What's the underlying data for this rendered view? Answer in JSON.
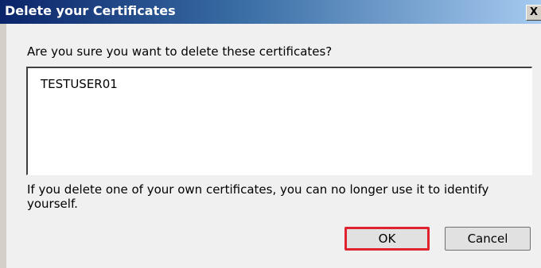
{
  "dialog": {
    "title": "Delete your Certificates",
    "close_label": "X",
    "prompt": "Are you sure you want to delete these certificates?",
    "certificates": [
      "TESTUSER01"
    ],
    "warning": "If you delete one of your own certificates, you can no longer use it to identify yourself.",
    "ok_label": "OK",
    "cancel_label": "Cancel"
  },
  "colors": {
    "titlebar": "#0a246a",
    "title_text": "#ffffff",
    "body_bg": "#f0f0f0",
    "ok_highlight": "#e0222e"
  }
}
